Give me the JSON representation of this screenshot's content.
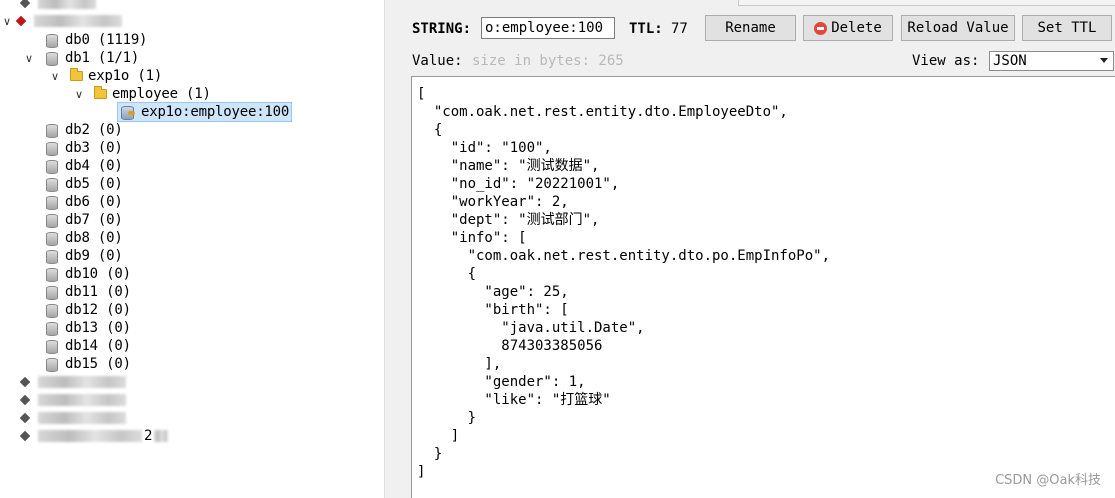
{
  "tree": {
    "servers_top": [
      {
        "redacted": true
      },
      {
        "redacted": true
      }
    ],
    "databases": [
      {
        "label": "db0 (1119)"
      },
      {
        "label": "db1  (1/1)"
      },
      {
        "label": "db2 (0)"
      },
      {
        "label": "db3 (0)"
      },
      {
        "label": "db4 (0)"
      },
      {
        "label": "db5 (0)"
      },
      {
        "label": "db6 (0)"
      },
      {
        "label": "db7 (0)"
      },
      {
        "label": "db8 (0)"
      },
      {
        "label": "db9 (0)"
      },
      {
        "label": "db10 (0)"
      },
      {
        "label": "db11 (0)"
      },
      {
        "label": "db12 (0)"
      },
      {
        "label": "db13 (0)"
      },
      {
        "label": "db14 (0)"
      },
      {
        "label": "db15 (0)"
      }
    ],
    "folder_1": "exp1o (1)",
    "folder_2": "employee (1)",
    "selected_key": "exp1o:employee:100",
    "servers_bottom_last_suffix": "2"
  },
  "toolbar": {
    "type_label": "STRING:",
    "key_value": "o:employee:100",
    "ttl_label": "TTL:",
    "ttl_value": "77",
    "rename_label": "Rename",
    "delete_label": "Delete",
    "reload_label": "Reload Value",
    "set_ttl_label": "Set TTL"
  },
  "value_bar": {
    "value_label": "Value:",
    "size_placeholder": "size in bytes: 265",
    "view_as_label": "View as:",
    "view_as_selected": "JSON"
  },
  "value_text": "[\n  \"com.oak.net.rest.entity.dto.EmployeeDto\",\n  {\n    \"id\": \"100\",\n    \"name\": \"测试数据\",\n    \"no_id\": \"20221001\",\n    \"workYear\": 2,\n    \"dept\": \"测试部门\",\n    \"info\": [\n      \"com.oak.net.rest.entity.dto.po.EmpInfoPo\",\n      {\n        \"age\": 25,\n        \"birth\": [\n          \"java.util.Date\",\n          874303385056\n        ],\n        \"gender\": 1,\n        \"like\": \"打篮球\"\n      }\n    ]\n  }\n]",
  "watermark": "CSDN @Oak科技"
}
